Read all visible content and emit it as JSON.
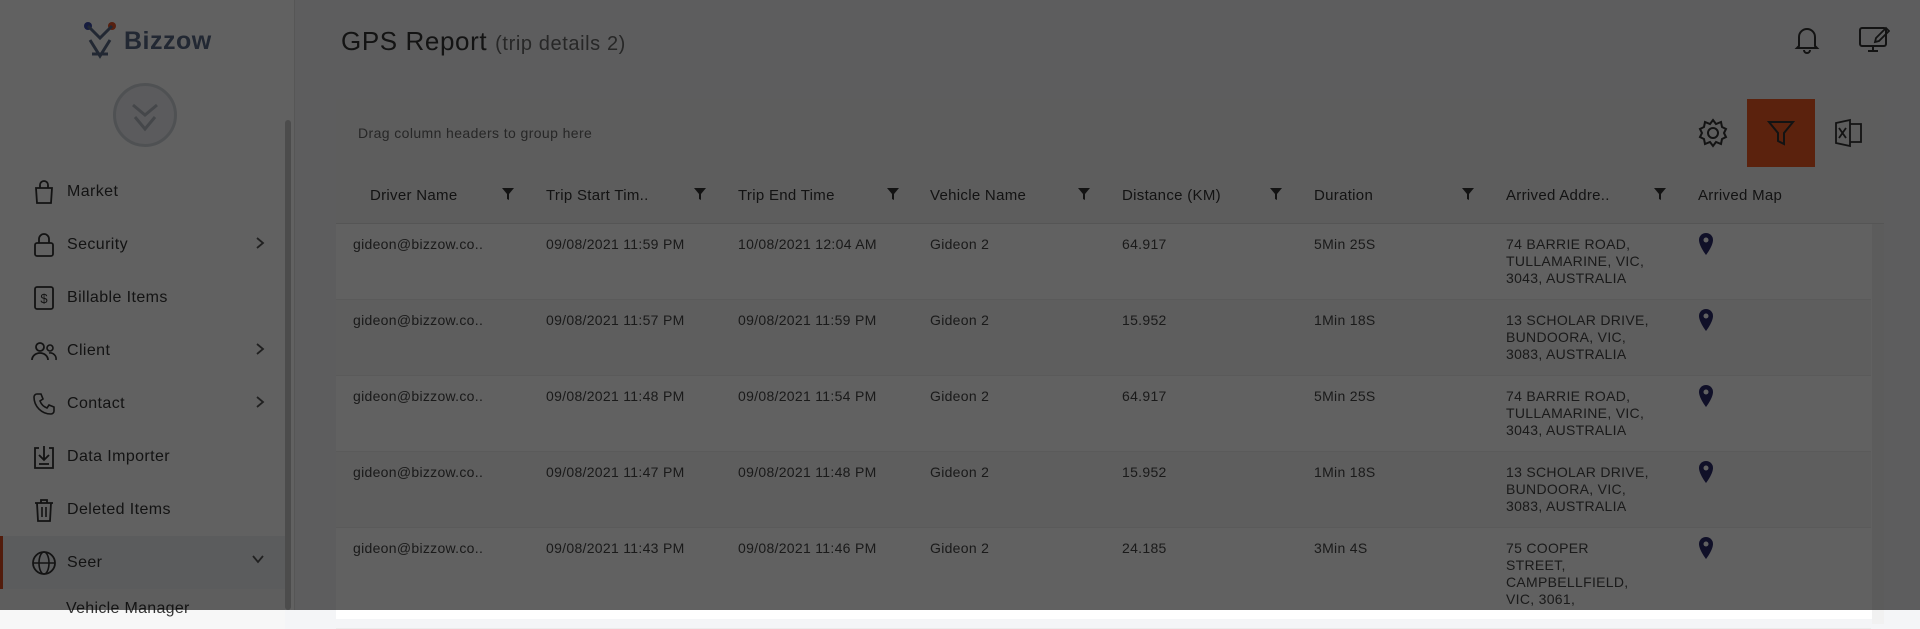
{
  "app": {
    "logo_text": "Bizzow"
  },
  "sidebar": {
    "items": [
      {
        "label": "Market",
        "icon": "shopping-bag-icon",
        "has_chevron": false
      },
      {
        "label": "Security",
        "icon": "lock-icon",
        "has_chevron": true
      },
      {
        "label": "Billable Items",
        "icon": "dollar-doc-icon",
        "has_chevron": false
      },
      {
        "label": "Client",
        "icon": "users-icon",
        "has_chevron": true
      },
      {
        "label": "Contact",
        "icon": "phone-icon",
        "has_chevron": true
      },
      {
        "label": "Data Importer",
        "icon": "import-icon",
        "has_chevron": false
      },
      {
        "label": "Deleted Items",
        "icon": "trash-icon",
        "has_chevron": false
      },
      {
        "label": "Seer",
        "icon": "globe-icon",
        "has_chevron": true,
        "active": true
      }
    ],
    "sub_items": [
      {
        "label": "Vehicle Manager"
      }
    ]
  },
  "page": {
    "title": "GPS Report",
    "subtitle": "(trip details 2)"
  },
  "grid": {
    "group_placeholder": "Drag column headers to group here",
    "columns": [
      "Driver Name",
      "Trip Start Tim..",
      "Trip End Time",
      "Vehicle Name",
      "Distance (KM)",
      "Duration",
      "Arrived Addre..",
      "Arrived Map"
    ],
    "rows": [
      {
        "driver": "gideon@bizzow.co..",
        "start": "09/08/2021 11:59 PM",
        "end": "10/08/2021 12:04 AM",
        "vehicle": "Gideon 2",
        "distance": "64.917",
        "duration": "5Min 25S",
        "address": "74 BARRIE ROAD, TULLAMARINE, VIC, 3043, AUSTRALIA"
      },
      {
        "driver": "gideon@bizzow.co..",
        "start": "09/08/2021 11:57 PM",
        "end": "09/08/2021 11:59 PM",
        "vehicle": "Gideon 2",
        "distance": "15.952",
        "duration": "1Min 18S",
        "address": "13 SCHOLAR DRIVE, BUNDOORA, VIC, 3083, AUSTRALIA"
      },
      {
        "driver": "gideon@bizzow.co..",
        "start": "09/08/2021 11:48 PM",
        "end": "09/08/2021 11:54 PM",
        "vehicle": "Gideon 2",
        "distance": "64.917",
        "duration": "5Min 25S",
        "address": "74 BARRIE ROAD, TULLAMARINE, VIC, 3043, AUSTRALIA"
      },
      {
        "driver": "gideon@bizzow.co..",
        "start": "09/08/2021 11:47 PM",
        "end": "09/08/2021 11:48 PM",
        "vehicle": "Gideon 2",
        "distance": "15.952",
        "duration": "1Min 18S",
        "address": "13 SCHOLAR DRIVE, BUNDOORA, VIC, 3083, AUSTRALIA"
      },
      {
        "driver": "gideon@bizzow.co..",
        "start": "09/08/2021 11:43 PM",
        "end": "09/08/2021 11:46 PM",
        "vehicle": "Gideon 2",
        "distance": "24.185",
        "duration": "3Min 4S",
        "address": "75 COOPER STREET, CAMPBELLFIELD, VIC, 3061,"
      }
    ]
  },
  "colors": {
    "accent": "#ef5a24",
    "active_border": "#d84b20",
    "pin": "#2b2a6b",
    "overlay": "rgba(0,0,0,0.62)"
  }
}
